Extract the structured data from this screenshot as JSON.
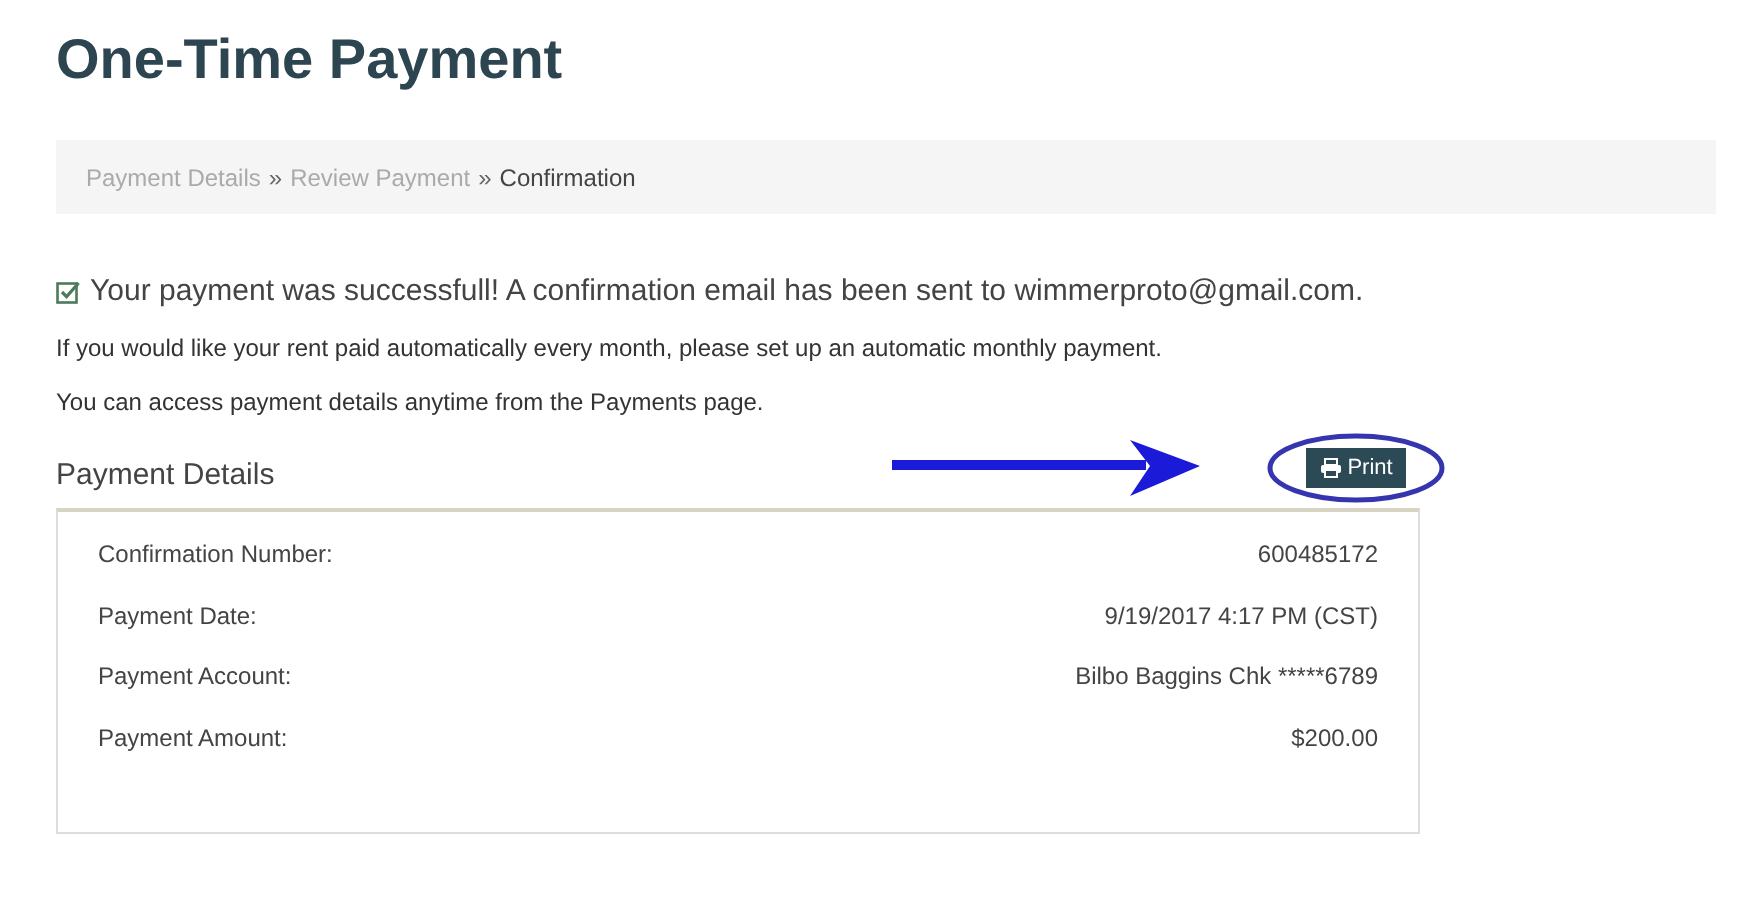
{
  "title": "One-Time Payment",
  "breadcrumb": {
    "separator": "»",
    "items": [
      {
        "label": "Payment Details",
        "selected": false
      },
      {
        "label": "Review Payment",
        "selected": false
      },
      {
        "label": "Confirmation",
        "selected": true
      }
    ]
  },
  "success_message": "Your payment was successfull! A confirmation email has been sent to wimmerproto@gmail.com.",
  "notes": [
    "If you would like your rent paid automatically every month, please set up an automatic monthly payment.",
    "You can access payment details anytime from the Payments page."
  ],
  "details": {
    "heading": "Payment Details",
    "print_button": "Print",
    "rows": [
      {
        "label": "Confirmation Number:",
        "value": "600485172"
      },
      {
        "label": "Payment Date:",
        "value": "9/19/2017 4:17 PM (CST)"
      },
      {
        "label": "Payment Account:",
        "value": "Bilbo Baggins Chk *****6789"
      },
      {
        "label": "Payment Amount:",
        "value": "$200.00"
      }
    ]
  }
}
